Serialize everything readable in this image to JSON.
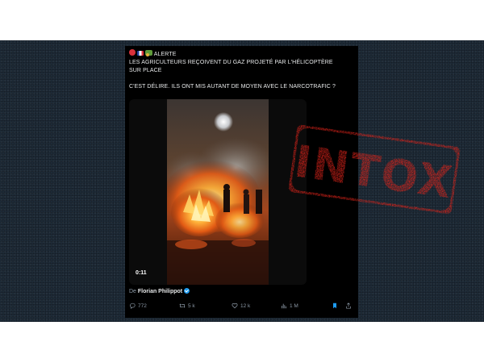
{
  "tweet": {
    "header_label": "ALERTE",
    "text_lines": [
      "LES AGRICULTEURS REÇOIVENT DU GAZ PROJETÉ PAR L'HÉLICOPTÈRE",
      "SUR PLACE",
      "",
      "C'EST DÉLIRE. ILS ONT MIS AUTANT DE MOYEN AVEC LE NARCOTRAFIC ?"
    ],
    "video_duration": "0:11",
    "via_prefix": "De",
    "via_author": "Florian Philippot",
    "stats": {
      "replies": "772",
      "reposts": "5 k",
      "likes": "12 k",
      "views": "1 M"
    }
  },
  "stamp": {
    "text": "INTOX",
    "color": "#e2231a"
  },
  "colors": {
    "backdrop": "#1d2a36",
    "tweet_bg": "#000000",
    "accent": "#1d9bf0"
  }
}
